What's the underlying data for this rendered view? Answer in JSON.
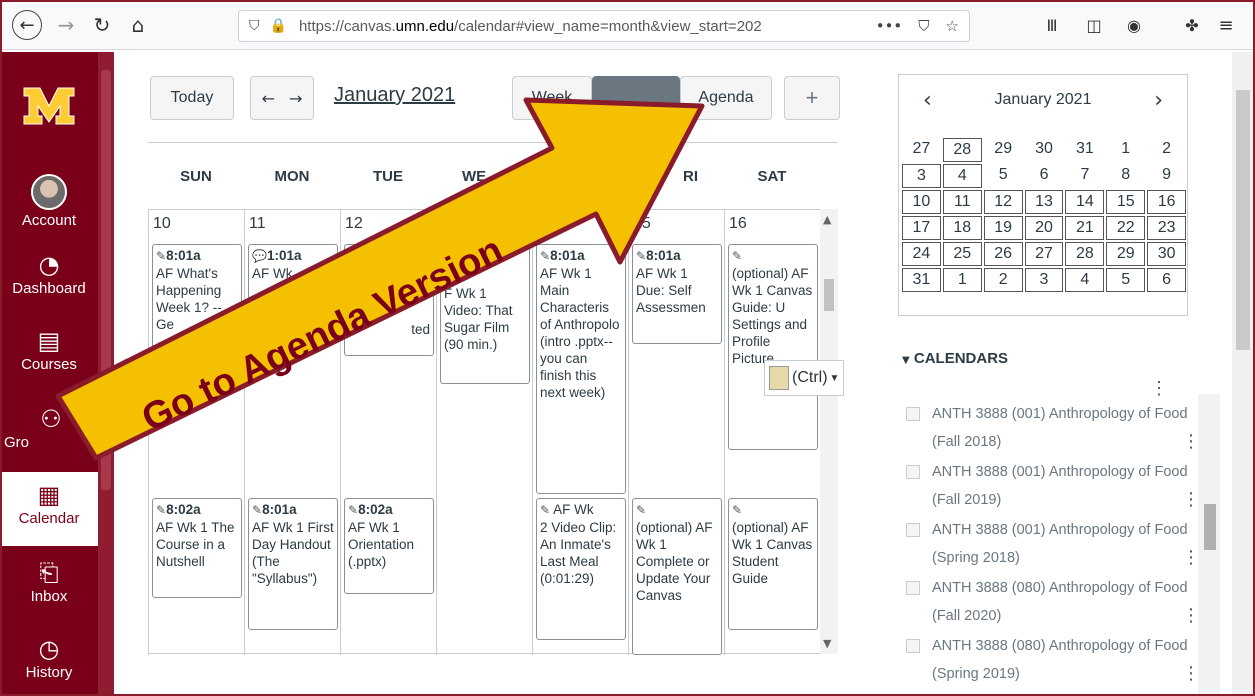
{
  "browser": {
    "url_prefix": "https://canvas.",
    "url_domain": "umn.edu",
    "url_suffix": "/calendar#view_name=month&view_start=202"
  },
  "sidebar": {
    "items": [
      {
        "label": "Account",
        "icon": "avatar"
      },
      {
        "label": "Dashboard",
        "icon": "dashboard-icon"
      },
      {
        "label": "Courses",
        "icon": "courses-icon"
      },
      {
        "label": "Gro",
        "icon": "groups-icon"
      },
      {
        "label": "Calendar",
        "icon": "calendar-icon"
      },
      {
        "label": "Inbox",
        "icon": "inbox-icon"
      },
      {
        "label": "History",
        "icon": "history-icon"
      }
    ]
  },
  "calendar": {
    "today_label": "Today",
    "month_label": "January 2021",
    "view_week": "Week",
    "view_agenda": "Agenda",
    "add_label": "+",
    "days": [
      "SUN",
      "MON",
      "TUE",
      "WE",
      "",
      "RI",
      "SAT"
    ],
    "dates": [
      "10",
      "11",
      "12",
      "",
      "",
      "15",
      "16"
    ],
    "events": {
      "sun1_time": "8:01a",
      "sun1_text": "AF What's Happening Week 1? -- Ge",
      "mon1_time": "1:01a",
      "mon1_text": "AF Wk",
      "tue1_text": "ted",
      "wed1_text": "F Wk 1 Video: That Sugar Film (90 min.)",
      "thu1_time": "8:01a",
      "thu1_text": "AF Wk 1 Main Characteris of Anthropolo (intro .pptx--you can finish this next week)",
      "fri1_time": "8:01a",
      "fri1_text": "AF Wk 1 Due: Self Assessmen",
      "sat1_text": "(optional) AF Wk 1 Canvas Guide: U Settings and Profile Picture",
      "sun2_time": "8:02a",
      "sun2_text": "AF Wk 1 The Course in a Nutshell",
      "mon2_time": "8:01a",
      "mon2_text": "AF Wk 1 First Day Handout (The \"Syllabus\")",
      "tue2_time": "8:02a",
      "tue2_text": "AF Wk 1 Orientation (.pptx)",
      "thu2_time": "AF Wk",
      "thu2_text": "2 Video Clip: An Inmate's Last Meal (0:01:29)",
      "fri2_text": "(optional) AF Wk 1 Complete or Update Your Canvas",
      "sat2_text": "(optional) AF Wk 1 Canvas Student Guide"
    },
    "paste_label": "(Ctrl)"
  },
  "mini_calendar": {
    "title": "January 2021",
    "rows": [
      [
        "27",
        "28",
        "29",
        "30",
        "31",
        "1",
        "2"
      ],
      [
        "3",
        "4",
        "5",
        "6",
        "7",
        "8",
        "9"
      ],
      [
        "10",
        "11",
        "12",
        "13",
        "14",
        "15",
        "16"
      ],
      [
        "17",
        "18",
        "19",
        "20",
        "21",
        "22",
        "23"
      ],
      [
        "24",
        "25",
        "26",
        "27",
        "28",
        "29",
        "30"
      ],
      [
        "31",
        "1",
        "2",
        "3",
        "4",
        "5",
        "6"
      ]
    ]
  },
  "calendars": {
    "heading": "CALENDARS",
    "items": [
      "ANTH 3888 (001) Anthropology of Food (Fall 2018)",
      "ANTH 3888 (001) Anthropology of Food (Fall 2019)",
      "ANTH 3888 (001) Anthropology of Food (Spring 2018)",
      "ANTH 3888 (080) Anthropology of Food (Fall 2020)",
      "ANTH 3888 (080) Anthropology of Food (Spring 2019)"
    ]
  },
  "annotation": {
    "text": "Go to Agenda Version",
    "color": "#f5c000"
  }
}
